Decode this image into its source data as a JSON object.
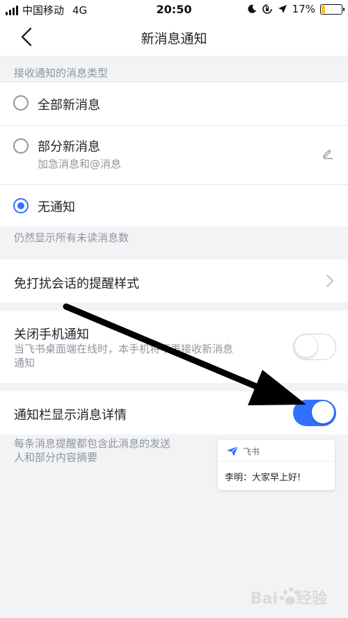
{
  "status_bar": {
    "carrier": "中国移动",
    "network": "4G",
    "time": "20:50",
    "battery": "17%",
    "battery_level": 0.17,
    "icons": [
      "signal-icon",
      "moon-icon",
      "rotation-lock-icon",
      "location-icon",
      "battery-icon"
    ]
  },
  "nav": {
    "title": "新消息通知",
    "back_icon": "chevron-left-icon"
  },
  "notify_types": {
    "header": "接收通知的消息类型",
    "options": [
      {
        "label": "全部新消息",
        "sub": "",
        "selected": false
      },
      {
        "label": "部分新消息",
        "sub": "加急消息和@消息",
        "selected": false,
        "edit_icon": "pencil-icon"
      },
      {
        "label": "无通知",
        "sub": "",
        "selected": true
      }
    ],
    "footer": "仍然显示所有未读消息数"
  },
  "dnd_style": {
    "label": "免打扰会话的提醒样式",
    "icon": "chevron-right-icon"
  },
  "phone_notify": {
    "label": "关闭手机通知",
    "desc_line1": "当飞书桌面端在线时，本手机将不再接收新消息",
    "desc_line2": "通知",
    "enabled": false
  },
  "detail_notify": {
    "label": "通知栏显示消息详情",
    "enabled": true,
    "desc_line1": "每条消息提醒都包含此消息的发送",
    "desc_line2": "人和部分内容摘要"
  },
  "preview": {
    "app_name": "飞书",
    "message": "李明：大家早上好!",
    "icon": "feishu-logo-icon"
  },
  "colors": {
    "accent": "#3370ff",
    "background": "#f2f3f5",
    "secondary_text": "#8f959e"
  },
  "watermark_text": "Bai du 经验"
}
